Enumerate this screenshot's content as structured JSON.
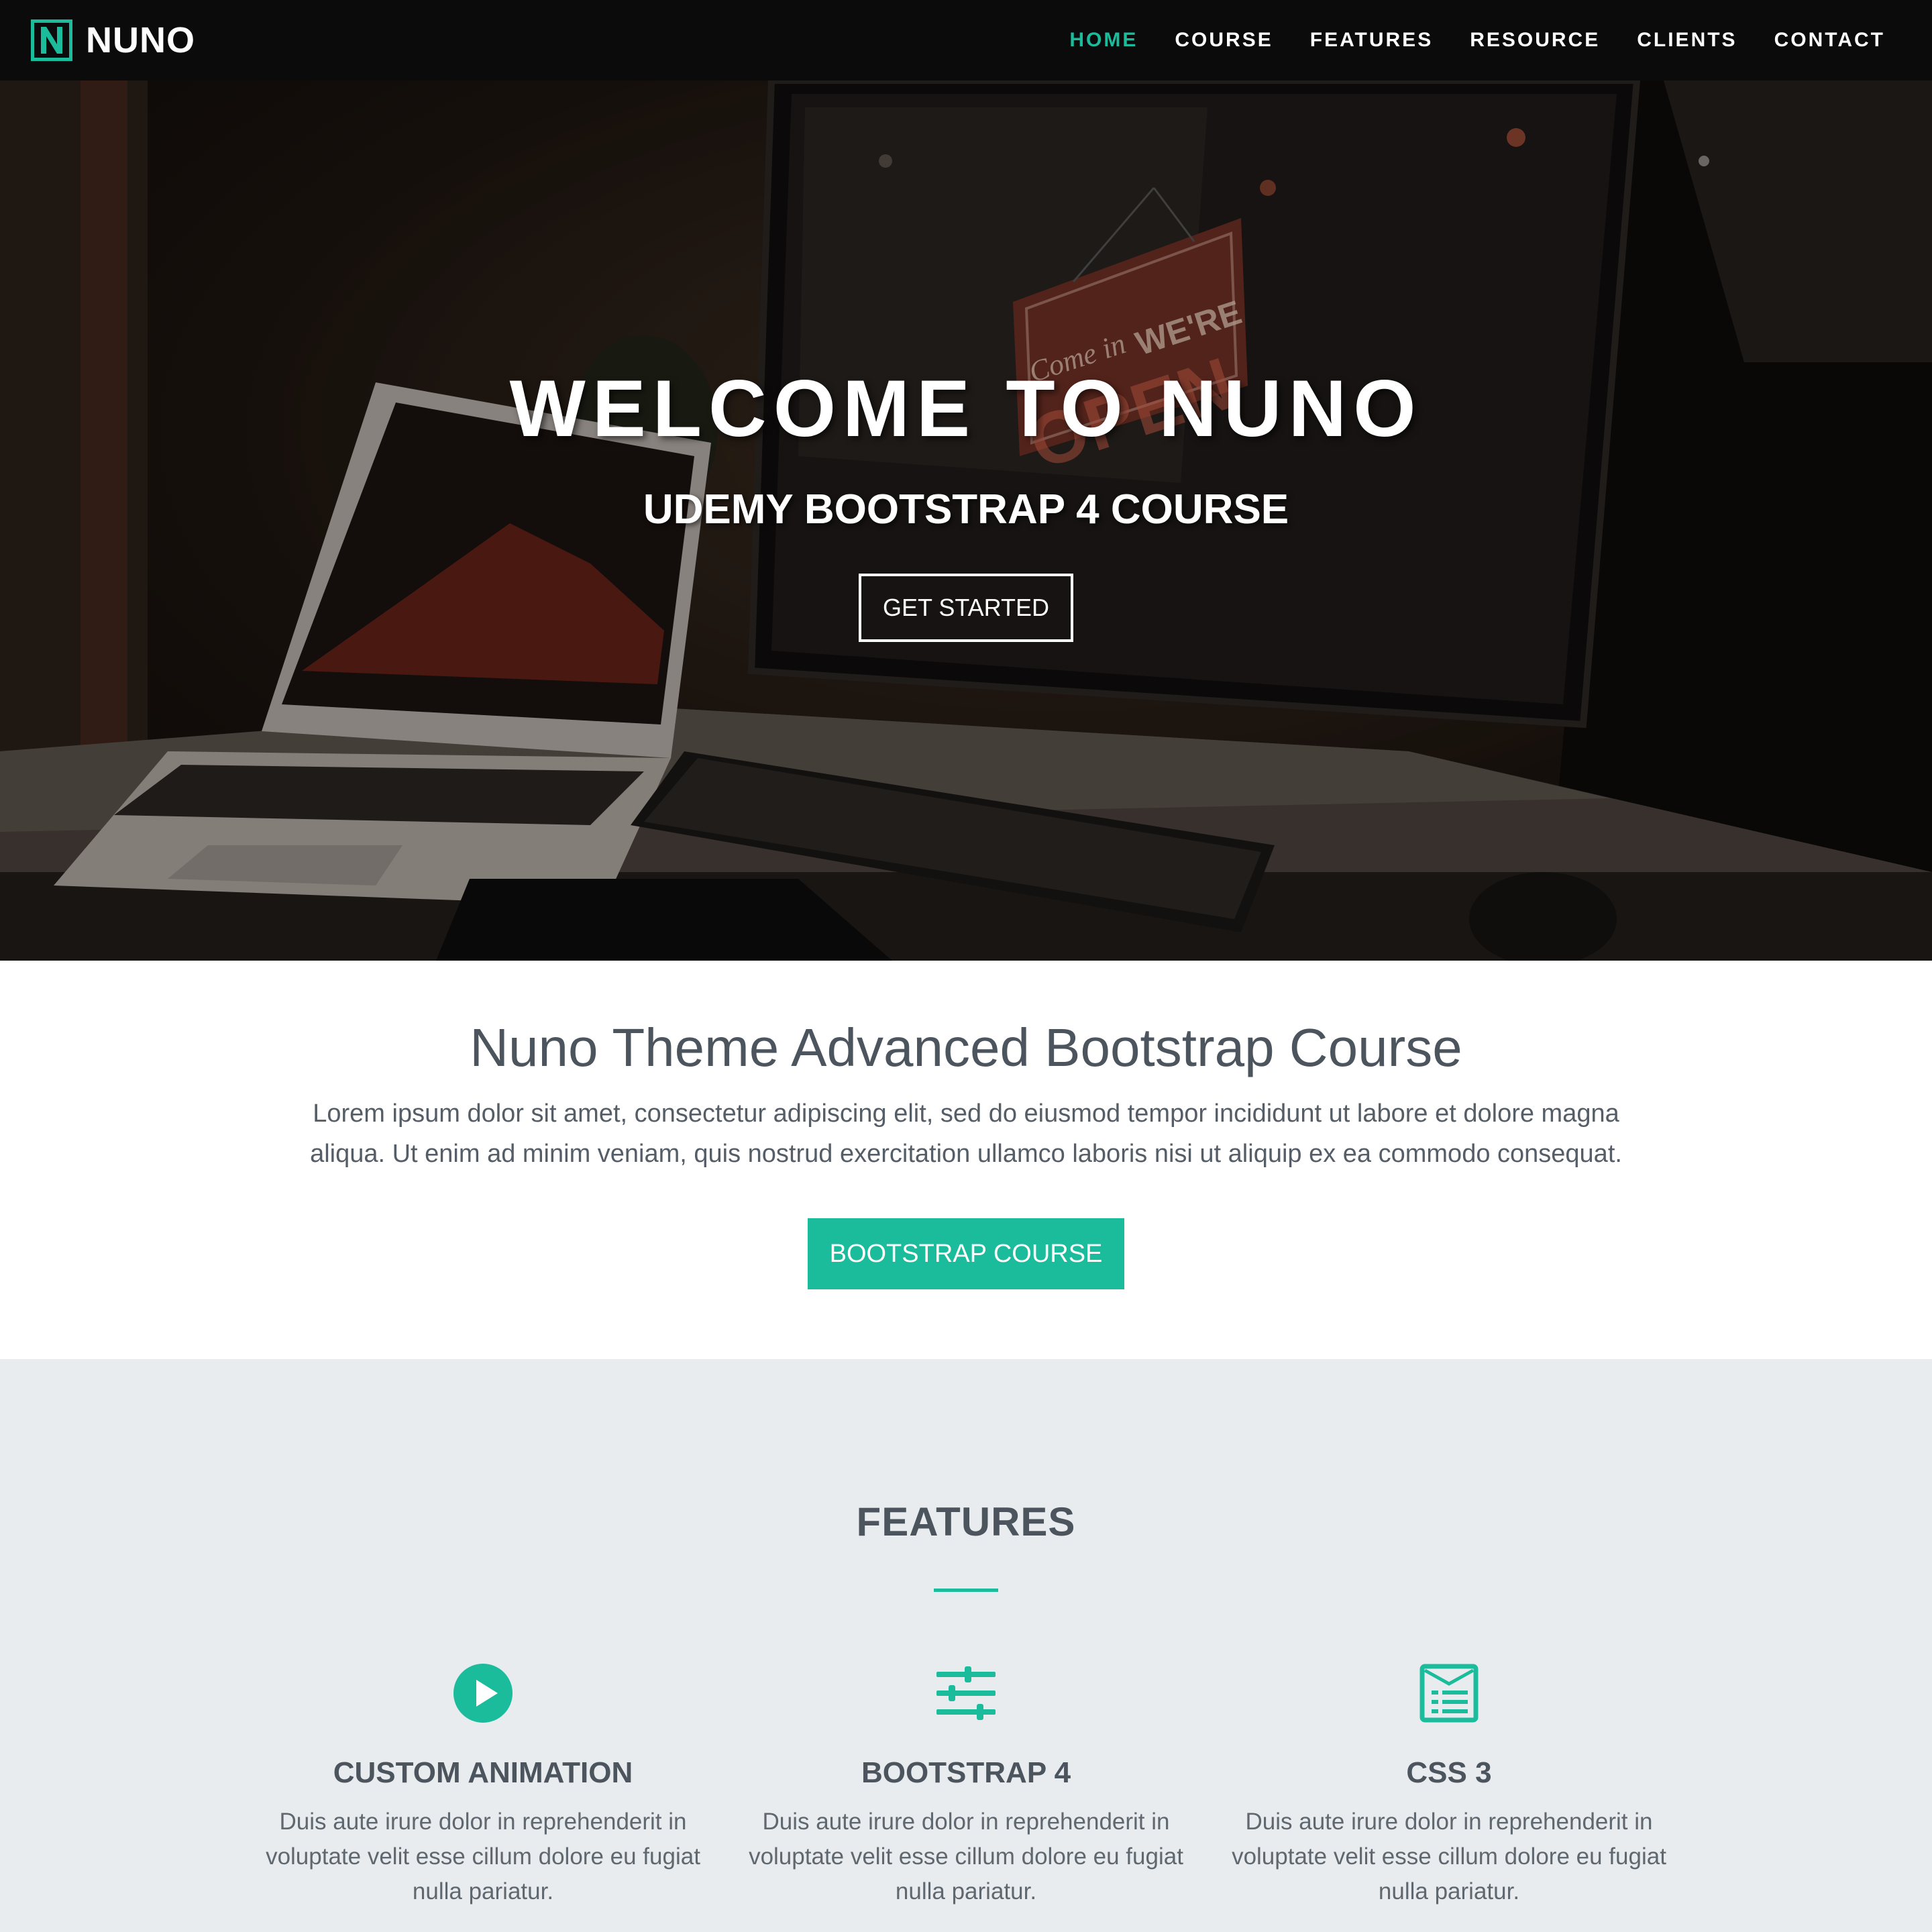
{
  "colors": {
    "accent": "#1abc9c",
    "navbar_bg": "#0b0b0b",
    "heading": "#4c545d",
    "features_bg": "#e9ecef"
  },
  "brand": {
    "logo_icon": "n-square-icon",
    "name": "NUNO"
  },
  "nav": {
    "items": [
      {
        "label": "HOME",
        "active": true
      },
      {
        "label": "COURSE"
      },
      {
        "label": "FEATURES"
      },
      {
        "label": "RESOURCE"
      },
      {
        "label": "CLIENTS"
      },
      {
        "label": "CONTACT"
      }
    ]
  },
  "hero": {
    "title": "WELCOME TO NUNO",
    "subtitle": "UDEMY BOOTSTRAP 4 COURSE",
    "button_label": "GET STARTED",
    "sign_text_script": "Come in",
    "sign_text_top": "WE'RE",
    "sign_text_bottom": "OPEN"
  },
  "intro": {
    "title": "Nuno Theme Advanced Bootstrap Course",
    "text": "Lorem ipsum dolor sit amet, consectetur adipiscing elit, sed do eiusmod tempor incididunt ut labore et dolore magna aliqua. Ut enim ad minim veniam, quis nostrud exercitation ullamco laboris nisi ut aliquip ex ea commodo consequat.",
    "button_label": "BOOTSTRAP COURSE"
  },
  "features": {
    "title": "FEATURES",
    "items": [
      {
        "icon": "play-circle-icon",
        "title": "CUSTOM ANIMATION",
        "text": "Duis aute irure dolor in reprehenderit in voluptate velit esse cillum dolore eu fugiat nulla pariatur."
      },
      {
        "icon": "sliders-icon",
        "title": "BOOTSTRAP 4",
        "text": "Duis aute irure dolor in reprehenderit in voluptate velit esse cillum dolore eu fugiat nulla pariatur."
      },
      {
        "icon": "browser-list-icon",
        "title": "CSS 3",
        "text": "Duis aute irure dolor in reprehenderit in voluptate velit esse cillum dolore eu fugiat nulla pariatur."
      }
    ]
  }
}
